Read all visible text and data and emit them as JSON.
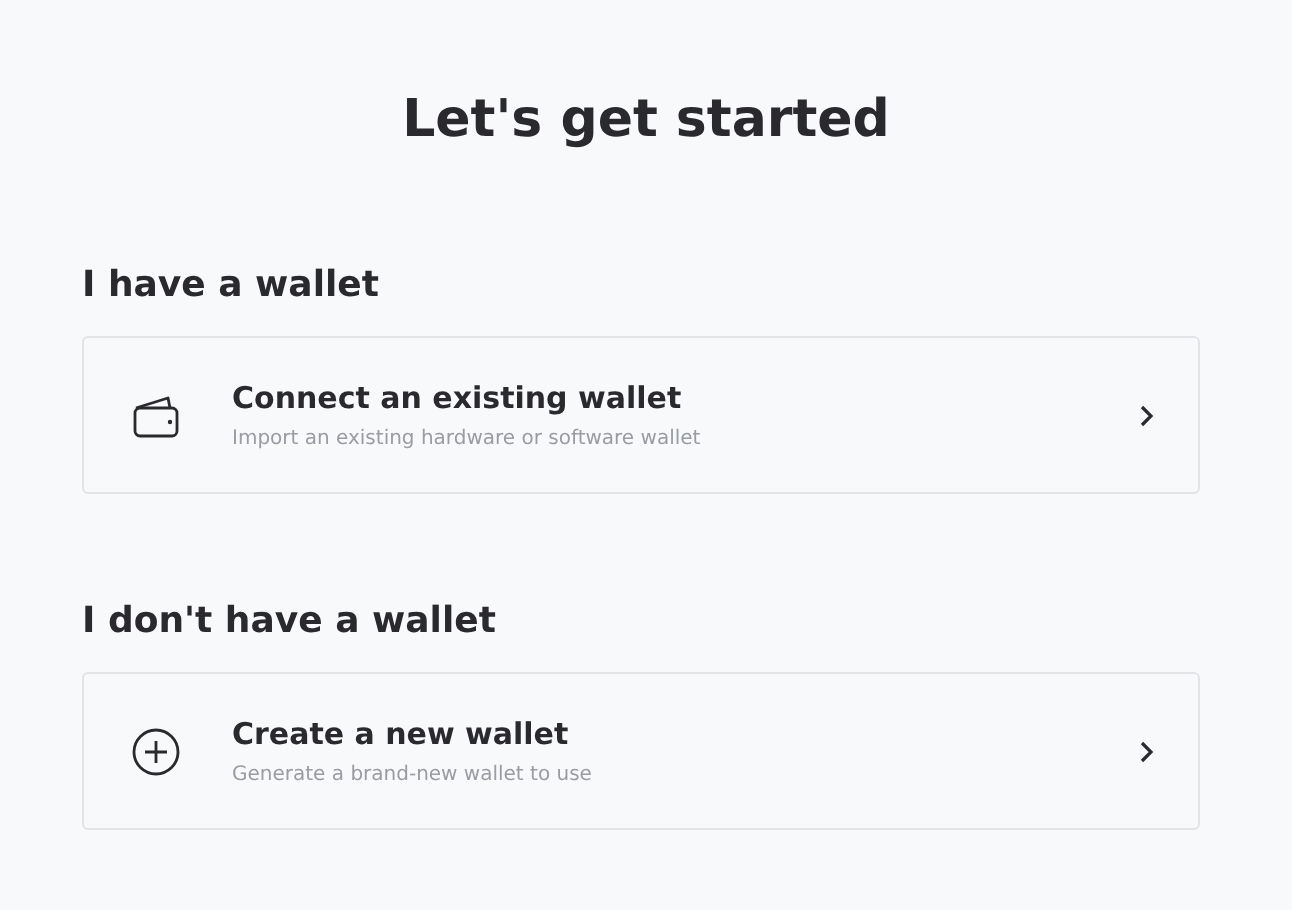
{
  "title": "Let's get started",
  "sections": [
    {
      "heading": "I have a wallet",
      "option": {
        "kind": "wallet",
        "title": "Connect an existing wallet",
        "subtitle": "Import an existing hardware or software wallet"
      }
    },
    {
      "heading": "I don't have a wallet",
      "option": {
        "kind": "create",
        "title": "Create a new wallet",
        "subtitle": "Generate a brand-new wallet to use"
      }
    }
  ]
}
